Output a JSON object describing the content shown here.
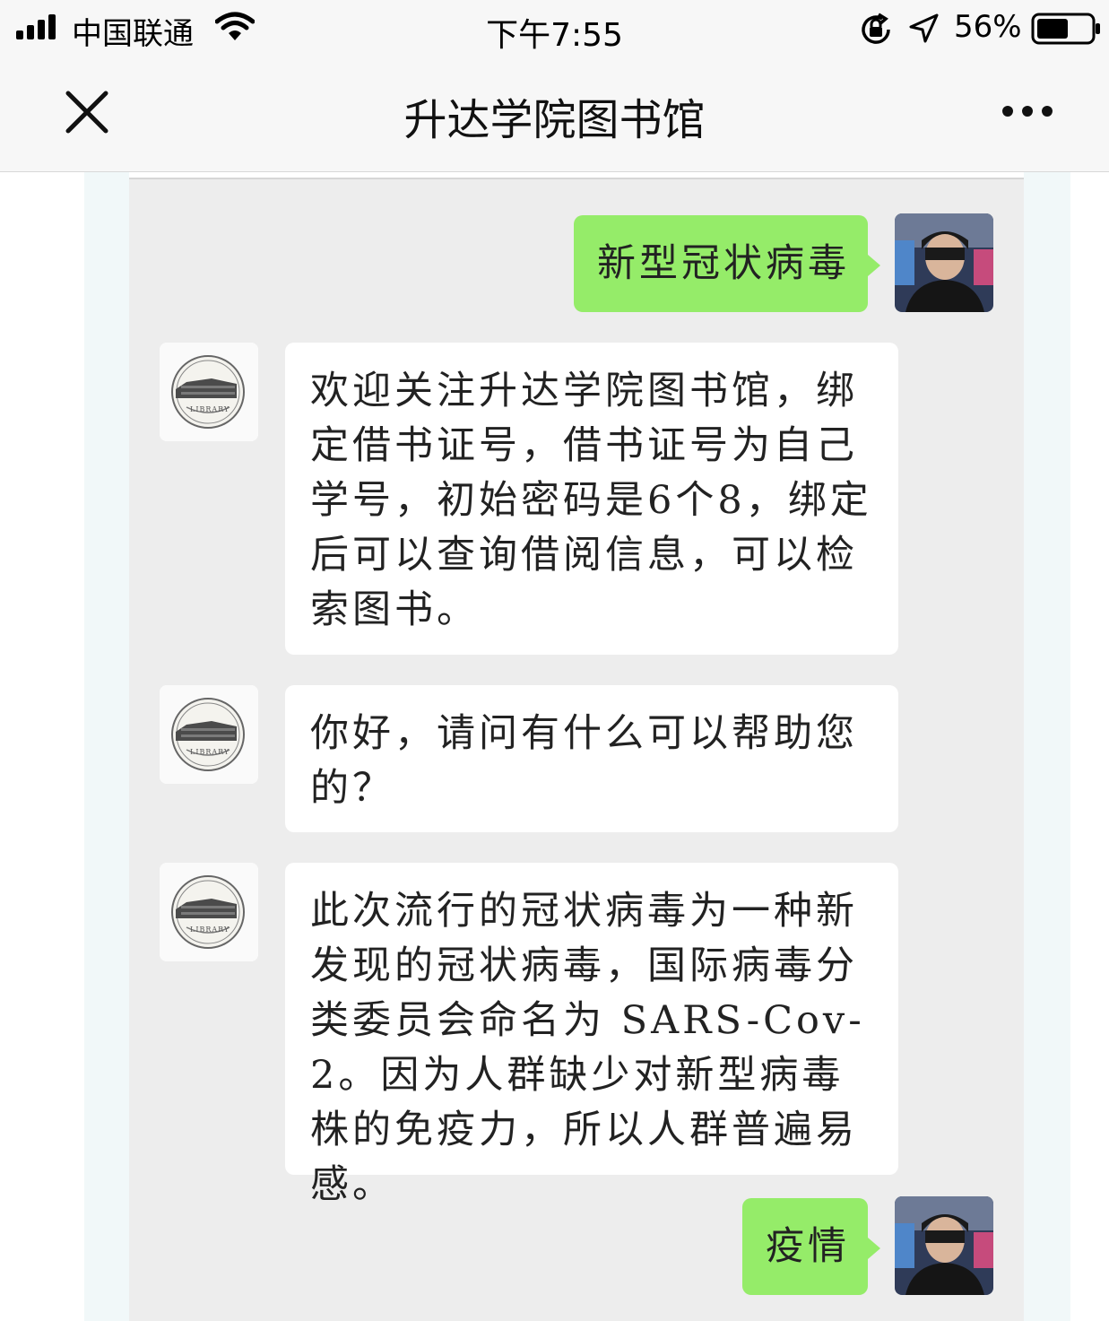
{
  "status_bar": {
    "carrier": "中国联通",
    "time": "下午7:55",
    "battery_percent": "56%",
    "icons": [
      "signal-icon",
      "wifi-icon",
      "orientation-lock-icon",
      "location-icon",
      "battery-icon"
    ]
  },
  "nav": {
    "title": "升达学院图书馆",
    "close_icon": "close-icon",
    "more_icon": "more-icon"
  },
  "messages": [
    {
      "sender": "user",
      "text": "新型冠状病毒"
    },
    {
      "sender": "library",
      "text": "欢迎关注升达学院图书馆，绑定借书证号，借书证号为自己学号，初始密码是6个8，绑定后可以查询借阅信息，可以检索图书。"
    },
    {
      "sender": "library",
      "text": "你好，请问有什么可以帮助您的？"
    },
    {
      "sender": "library",
      "text": "此次流行的冠状病毒为一种新发现的冠状病毒，国际病毒分类委员会命名为 SARS-Cov-2。因为人群缺少对新型病毒株的免疫力，所以人群普遍易感。"
    },
    {
      "sender": "user",
      "text": "疫情"
    }
  ],
  "library_avatar": {
    "label": "LIBRARY"
  },
  "colors": {
    "user_bubble": "#95ec69",
    "library_bubble": "#ffffff",
    "chat_background": "#ededed",
    "nav_background": "#f7f7f7"
  }
}
